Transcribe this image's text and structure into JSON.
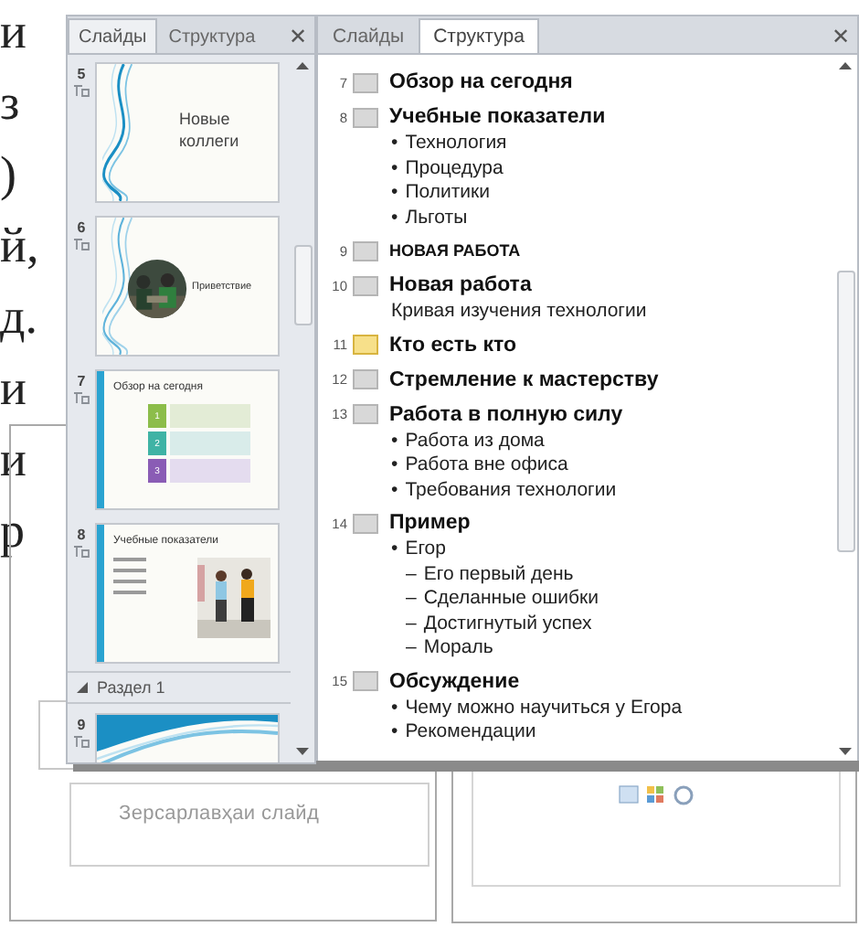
{
  "book_text_fragments": [
    "и",
    "з",
    ")",
    "й,",
    "д.",
    "и",
    "и",
    "р"
  ],
  "slide_editor": {
    "title_placeholder": "Зерсарлавҳаи слайд"
  },
  "slides_panel": {
    "tabs": [
      {
        "label": "Слайды",
        "selected": true
      },
      {
        "label": "Структура",
        "selected": false
      }
    ],
    "close": "✕",
    "items": [
      {
        "kind": "title",
        "number": "5",
        "title": "Новые коллеги"
      },
      {
        "number": "6",
        "title": "Приветствие"
      },
      {
        "kind": "steps",
        "number": "7",
        "title": "Обзор на сегодня",
        "steps": [
          "1",
          "2",
          "3"
        ]
      },
      {
        "kind": "gallery",
        "number": "8",
        "title": "Учебные показатели"
      },
      {
        "kind": "section",
        "label": "Раздел 1"
      },
      {
        "kind": "wave",
        "number": "9"
      }
    ]
  },
  "outline_panel": {
    "tabs": [
      {
        "label": "Слайды",
        "selected": false
      },
      {
        "label": "Структура",
        "selected": true
      }
    ],
    "close": "✕",
    "slides": [
      {
        "number": "7",
        "title": "Обзор на сегодня",
        "current": false
      },
      {
        "number": "8",
        "title": "Учебные показатели",
        "current": false,
        "children": [
          {
            "marker": "•",
            "text": "Технология"
          },
          {
            "marker": "•",
            "text": "Процедура"
          },
          {
            "marker": "•",
            "text": "Политики"
          },
          {
            "marker": "•",
            "text": "Льготы"
          }
        ]
      },
      {
        "number": "9",
        "title": "НОВАЯ РАБОТА",
        "kind": "caps",
        "current": false
      },
      {
        "number": "10",
        "title": "Новая работа",
        "current": false,
        "children": [
          {
            "text": "Кривая изучения технологии"
          }
        ]
      },
      {
        "number": "11",
        "title": "Кто есть кто",
        "current": true
      },
      {
        "number": "12",
        "title": "Стремление к мастерству",
        "current": false
      },
      {
        "number": "13",
        "title": "Работа в полную силу",
        "current": false,
        "children": [
          {
            "marker": "•",
            "text": "Работа из дома"
          },
          {
            "marker": "•",
            "text": "Работа вне офиса"
          },
          {
            "marker": "•",
            "text": "Требования технологии"
          }
        ]
      },
      {
        "number": "14",
        "title": "Пример",
        "current": false,
        "children": [
          {
            "marker": "•",
            "text": "Егор",
            "children": [
              {
                "marker": "–",
                "text": "Его первый день"
              },
              {
                "marker": "–",
                "text": "Сделанные ошибки"
              },
              {
                "marker": "–",
                "text": "Достигнутый успех"
              },
              {
                "marker": "–",
                "text": "Мораль"
              }
            ]
          }
        ]
      },
      {
        "number": "15",
        "title": "Обсуждение",
        "current": false,
        "children": [
          {
            "marker": "•",
            "text": "Чему можно научиться у Егора"
          },
          {
            "marker": "•",
            "text": "Рекомендации"
          }
        ]
      }
    ]
  }
}
